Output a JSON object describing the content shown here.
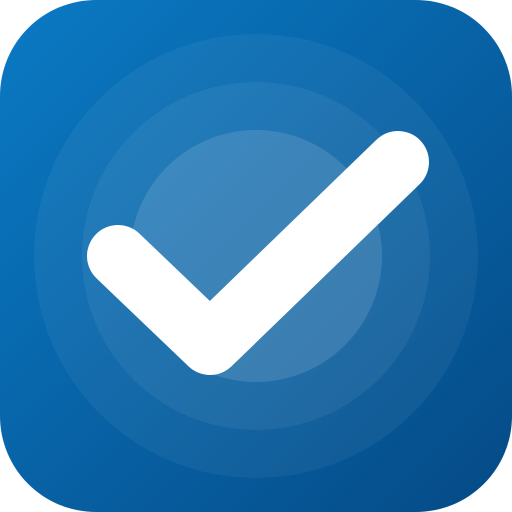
{
  "app_icon": {
    "icon": "checkmark-icon",
    "colors": {
      "gradient_top": "#0a7ac4",
      "gradient_bottom": "#054a86",
      "ring": "#ffffff",
      "check": "#ffffff"
    }
  }
}
